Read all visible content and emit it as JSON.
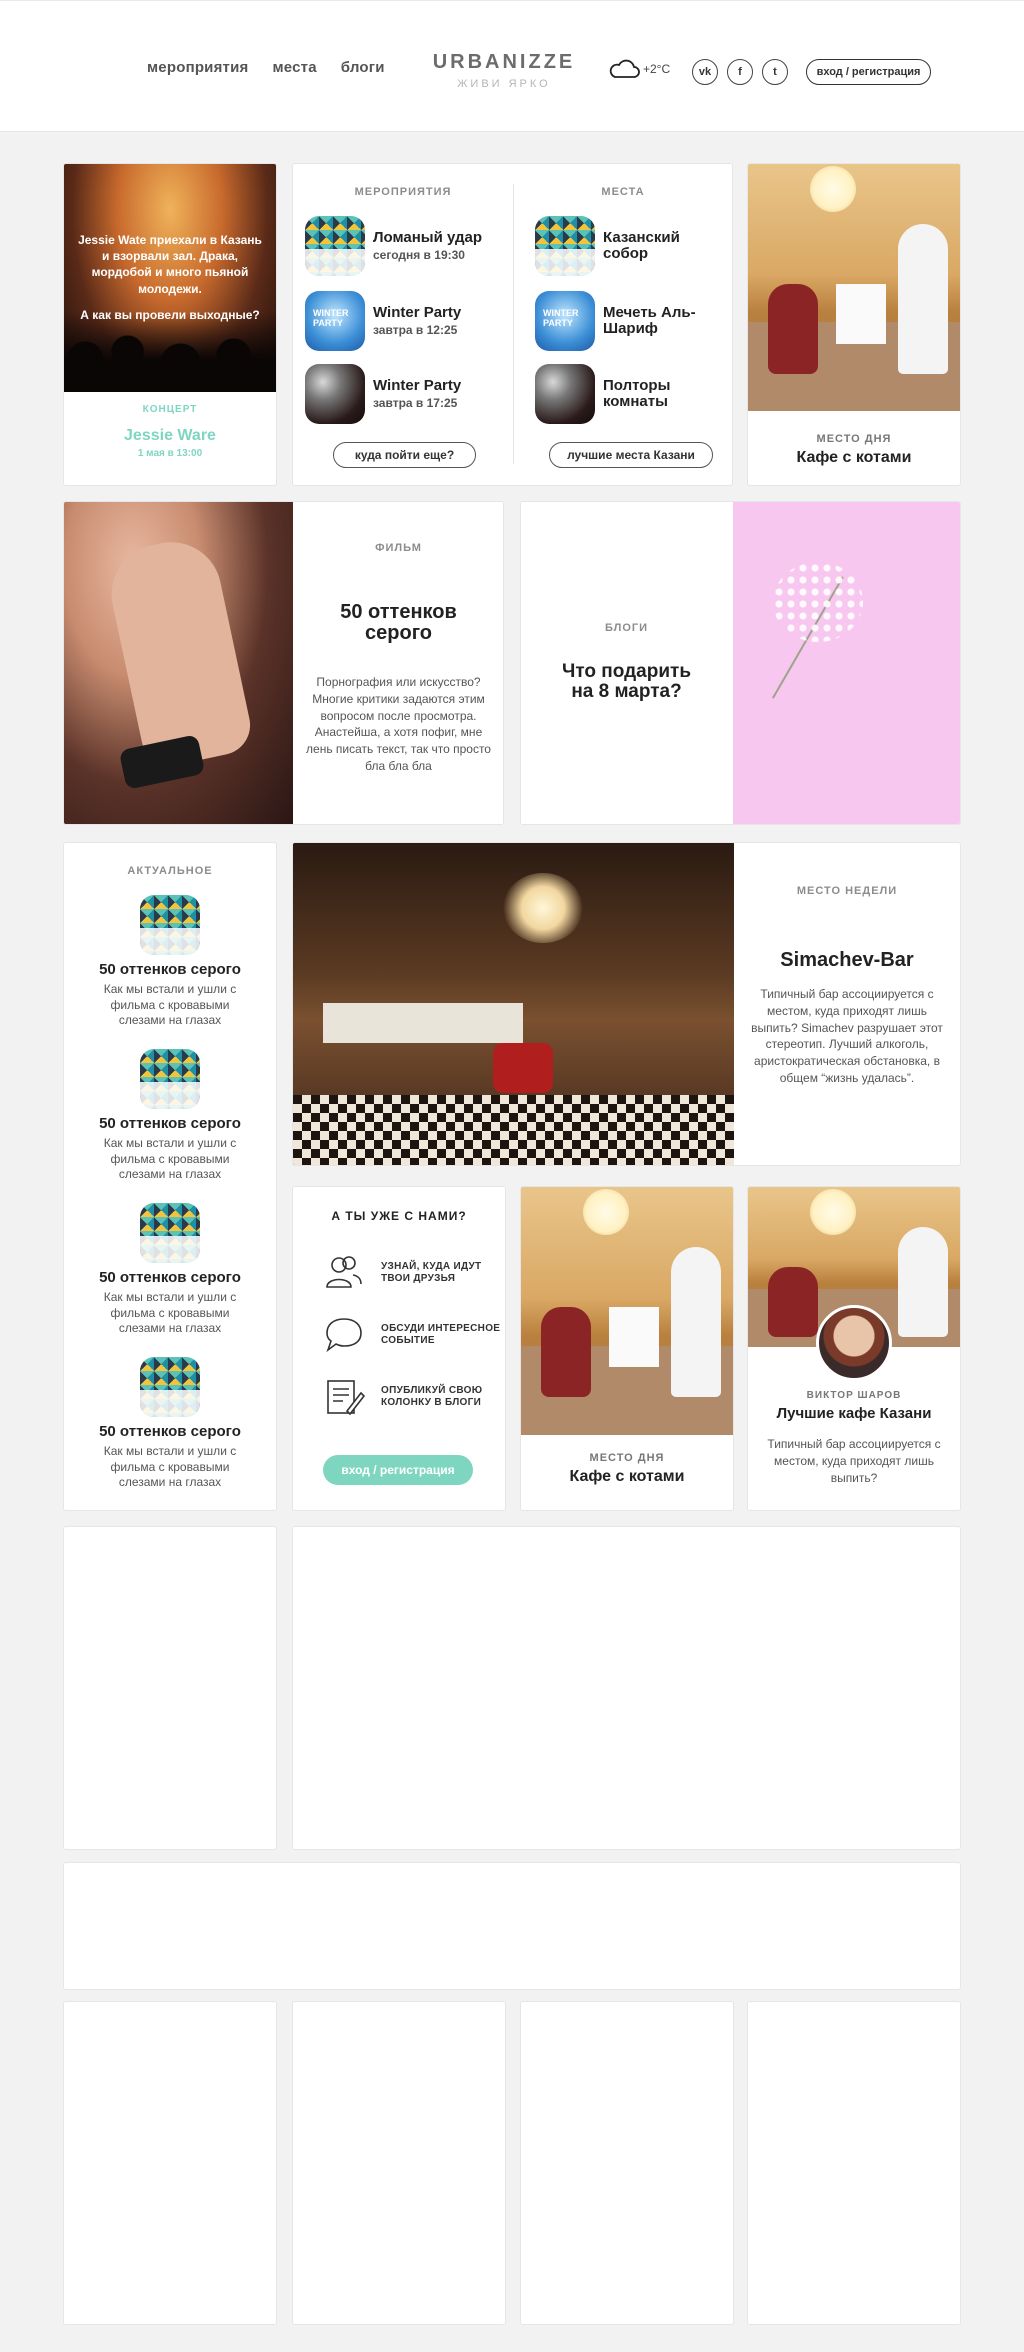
{
  "header": {
    "nav": [
      "мероприятия",
      "места",
      "блоги"
    ],
    "logo": {
      "name": "URBANIZZE",
      "tagline": "ЖИВИ ЯРКО"
    },
    "weather": {
      "icon": "cloud-icon",
      "temp": "+2°C"
    },
    "socials": [
      {
        "icon": "vk-icon",
        "label": "vk"
      },
      {
        "icon": "facebook-icon",
        "label": "f"
      },
      {
        "icon": "twitter-icon",
        "label": "t"
      }
    ],
    "login_label": "вход / регистрация"
  },
  "concert": {
    "headline": "Jessie Wate приехали в Казань и взорвали зал. Драка, мордобой и много пьяной молодежи.",
    "question": "А как вы провели выходные?",
    "category": "КОНЦЕРТ",
    "title": "Jessie Ware",
    "date": "1 мая в 13:00"
  },
  "events": {
    "heading": "МЕРОПРИЯТИЯ",
    "items": [
      {
        "title": "Ломаный удар",
        "time": "сегодня в 19:30"
      },
      {
        "title": "Winter Party",
        "time": "завтра в 12:25"
      },
      {
        "title": "Winter Party",
        "time": "завтра в 17:25"
      }
    ],
    "more_label": "куда пойти еще?"
  },
  "places": {
    "heading": "МЕСТА",
    "items": [
      {
        "title": "Казанский собор"
      },
      {
        "title": "Мечеть Аль-Шариф"
      },
      {
        "title": "Полторы комнаты"
      }
    ],
    "more_label": "лучшие места Казани"
  },
  "place_of_day": {
    "label": "МЕСТО ДНЯ",
    "title": "Кафе с котами"
  },
  "film": {
    "label": "ФИЛЬМ",
    "title": "50 оттенков серого",
    "text": "Порнография или искусство? Многие критики задаются этим вопросом после просмотра. Анастейша, а хотя пофиг, мне лень писать текст, так что просто бла бла бла"
  },
  "blogs": {
    "label": "БЛОГИ",
    "title": "Что подарить на 8 марта?"
  },
  "actual": {
    "heading": "АКТУАЛЬНОЕ",
    "items": [
      {
        "title": "50 оттенков серого",
        "desc": "Как мы встали и ушли с фильма с кровавыми слезами на глазах"
      },
      {
        "title": "50 оттенков серого",
        "desc": "Как мы встали и ушли с фильма с кровавыми слезами на глазах"
      },
      {
        "title": "50 оттенков серого",
        "desc": "Как мы встали и ушли с фильма с кровавыми слезами на глазах"
      },
      {
        "title": "50 оттенков серого",
        "desc": "Как мы встали и ушли с фильма с кровавыми слезами на глазах"
      }
    ]
  },
  "place_of_week": {
    "label": "МЕСТО НЕДЕЛИ",
    "title": "Simachev-Bar",
    "text": "Типичный бар ассоциируется с местом, куда приходят лишь выпить? Simachev разрушает этот стереотип. Лучший алкоголь, аристократическая обстановка, в общем “жизнь удалась”."
  },
  "join": {
    "heading": "А ТЫ УЖЕ С НАМИ?",
    "features": [
      {
        "icon": "friends-icon",
        "text": "УЗНАЙ, КУДА ИДУТ ТВОИ ДРУЗЬЯ"
      },
      {
        "icon": "chat-bubble-icon",
        "text": "ОБСУДИ ИНТЕРЕСНОЕ СОБЫТИЕ"
      },
      {
        "icon": "write-column-icon",
        "text": "ОПУБЛИКУЙ СВОЮ КОЛОНКУ В БЛОГИ"
      }
    ],
    "button_label": "вход / регистрация"
  },
  "place_of_day_2": {
    "label": "МЕСТО ДНЯ",
    "title": "Кафе с котами"
  },
  "author_post": {
    "author": "ВИКТОР ШАРОВ",
    "title": "Лучшие кафе Казани",
    "text": "Типичный бар ассоциируется с местом, куда приходят лишь выпить?"
  },
  "colors": {
    "accent": "#7fd6c0",
    "pink": "#f8c7ef",
    "background": "#f2f2f2"
  }
}
